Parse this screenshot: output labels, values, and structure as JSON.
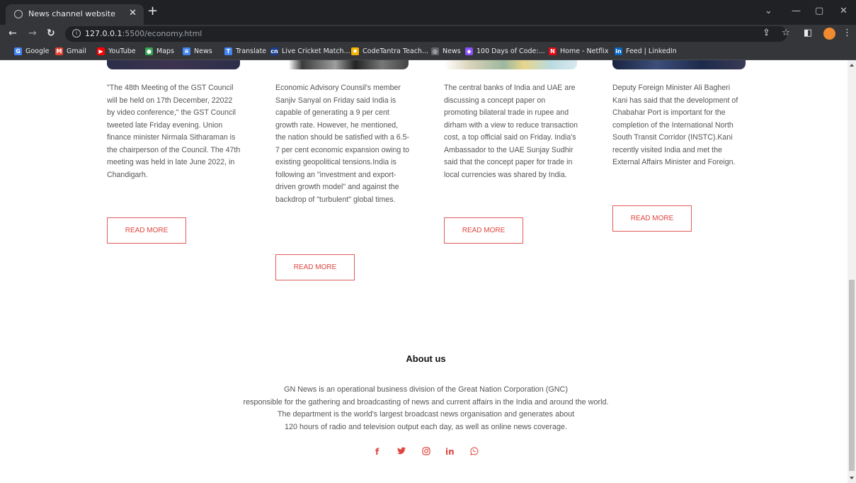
{
  "browser": {
    "tab_title": "News channel website",
    "new_tab": "+",
    "url_host": "127.0.0.1",
    "url_rest": ":5500/economy.html"
  },
  "bookmarks": [
    {
      "label": "Google",
      "icon": "google-icon",
      "color": "#4285f4",
      "glyph": "G"
    },
    {
      "label": "Gmail",
      "icon": "gmail-icon",
      "color": "#ea4335",
      "glyph": "M"
    },
    {
      "label": "YouTube",
      "icon": "youtube-icon",
      "color": "#ff0000",
      "glyph": "▶"
    },
    {
      "label": "Maps",
      "icon": "maps-icon",
      "color": "#34a853",
      "glyph": "●"
    },
    {
      "label": "News",
      "icon": "google-news-icon",
      "color": "#4285f4",
      "glyph": "≡"
    },
    {
      "label": "Translate",
      "icon": "translate-icon",
      "color": "#4285f4",
      "glyph": "T"
    },
    {
      "label": "Live Cricket Match...",
      "icon": "cricket-icon",
      "color": "#1a3d8f",
      "glyph": "cn"
    },
    {
      "label": "CodeTantra Teach...",
      "icon": "codetantra-icon",
      "color": "#f4b400",
      "glyph": "✸"
    },
    {
      "label": "News",
      "icon": "globe-icon",
      "color": "#5f6368",
      "glyph": "◎"
    },
    {
      "label": "100 Days of Code:...",
      "icon": "replit-icon",
      "color": "#8a4fff",
      "glyph": "◆"
    },
    {
      "label": "Home - Netflix",
      "icon": "netflix-icon",
      "color": "#e50914",
      "glyph": "N"
    },
    {
      "label": "Feed | LinkedIn",
      "icon": "linkedin-icon",
      "color": "#0a66c2",
      "glyph": "in"
    }
  ],
  "articles": [
    {
      "text": "\"The 48th Meeting of the GST Council will be held on 17th December, 22022 by video conference,\" the GST Council tweeted late Friday evening. Union finance minister Nirmala Sitharaman is the chairperson of the Council. The 47th meeting was held in late June 2022, in Chandigarh.",
      "button": "READ MORE"
    },
    {
      "text": "Economic Advisory Counsil's member Sanjiv Sanyal on Friday said India is capable of generating a 9 per cent growth rate. However, he mentioned, the nation should be satisfied with a 6.5-7 per cent economic expansion owing to existing geopolitical tensions.India is following an \"investment and export-driven growth model\" and against the backdrop of \"turbulent\" global times.",
      "button": "READ MORE"
    },
    {
      "text": "The central banks of India and UAE are discussing a concept paper on promoting bilateral trade in rupee and dirham with a view to reduce transaction cost, a top official said on Friday. India's Ambassador to the UAE Sunjay Sudhir said that the concept paper for trade in local currencies was shared by India.",
      "button": "READ MORE"
    },
    {
      "text": "Deputy Foreign Minister Ali Bagheri Kani has said that the development of Chabahar Port is important for the completion of the International North South Transit Corridor (INSTC).Kani recently visited India and met the External Affairs Minister and Foreign.",
      "button": "READ MORE"
    }
  ],
  "about": {
    "title": "About us",
    "lines": [
      "GN News is an operational business division of the Great Nation Corporation (GNC)",
      "responsible for the gathering and broadcasting of news and current affairs in the India and around the world.",
      "The department is the world's largest broadcast news organisation and generates about",
      "120 hours of radio and television output each day, as well as online news coverage."
    ]
  },
  "social": [
    {
      "name": "facebook-icon",
      "glyph": "f"
    },
    {
      "name": "twitter-icon",
      "glyph": "🐦"
    },
    {
      "name": "instagram-icon",
      "glyph": "◎"
    },
    {
      "name": "linkedin-icon",
      "glyph": "in"
    },
    {
      "name": "whatsapp-icon",
      "glyph": "✆"
    }
  ],
  "colors": {
    "accent": "#e0453f",
    "text": "#555555",
    "chrome_dark": "#202124",
    "chrome": "#35363a"
  }
}
